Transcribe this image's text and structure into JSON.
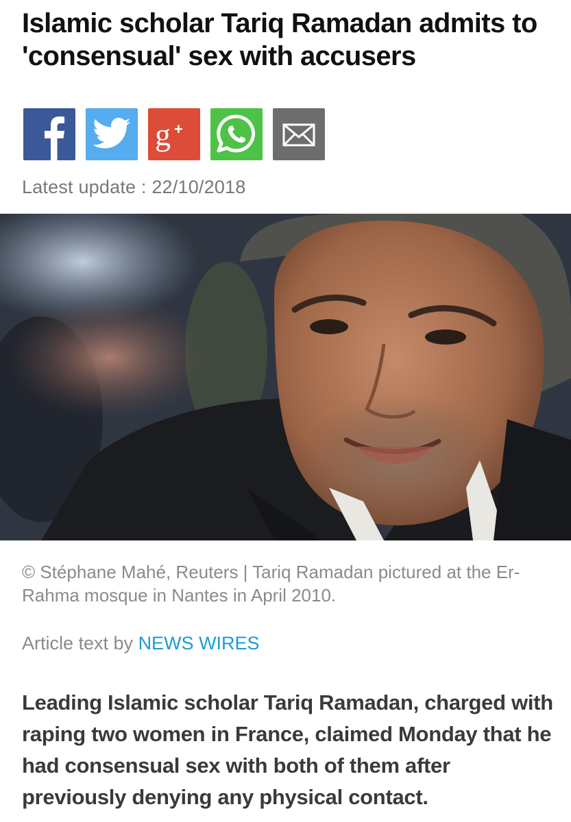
{
  "article": {
    "headline": "Islamic scholar Tariq Ramadan admits to 'consensual' sex with accusers",
    "update_label": "Latest update : 22/10/2018",
    "caption": "© Stéphane Mahé, Reuters | Tariq Ramadan pictured at the Er-Rahma mosque in Nantes in April 2010.",
    "byline_prefix": "Article text by ",
    "byline_source": "NEWS WIRES",
    "lead": "Leading Islamic scholar Tariq Ramadan, charged with raping two women in France, claimed Monday that he had consensual sex with both of them after previously denying any physical contact."
  },
  "share": {
    "buttons": [
      {
        "icon": "facebook-icon",
        "color": "#3b5998"
      },
      {
        "icon": "twitter-icon",
        "color": "#55acee"
      },
      {
        "icon": "google-plus-icon",
        "color": "#dd4b39"
      },
      {
        "icon": "whatsapp-icon",
        "color": "#4dc247"
      },
      {
        "icon": "email-icon",
        "color": "#6d6d6d"
      }
    ]
  },
  "colors": {
    "link": "#1a9bd7",
    "meta_text": "#8a8a8a"
  }
}
